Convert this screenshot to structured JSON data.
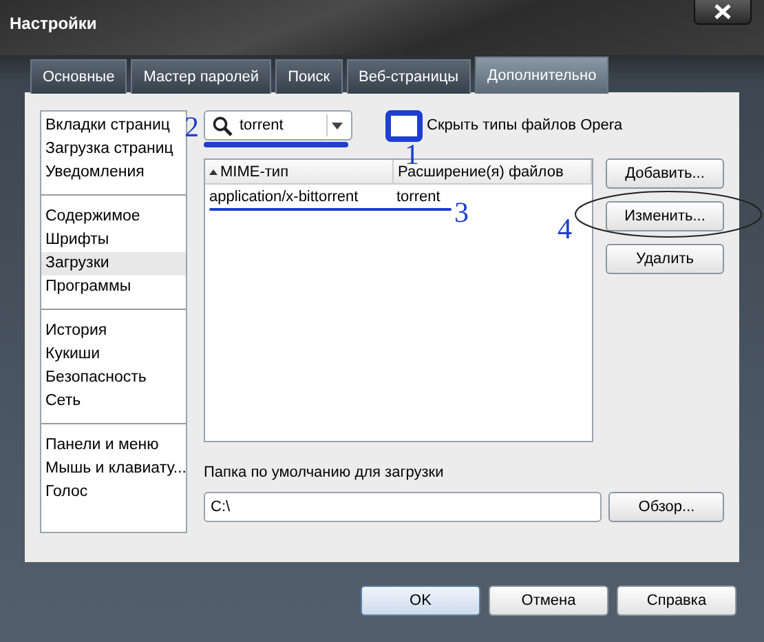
{
  "window": {
    "title": "Настройки"
  },
  "tabs": [
    {
      "label": "Основные",
      "selected": false
    },
    {
      "label": "Мастер паролей",
      "selected": false
    },
    {
      "label": "Поиск",
      "selected": false
    },
    {
      "label": "Веб-страницы",
      "selected": false
    },
    {
      "label": "Дополнительно",
      "selected": true
    }
  ],
  "sidebar": {
    "groups": [
      {
        "items": [
          {
            "label": "Вкладки страниц",
            "selected": false
          },
          {
            "label": "Загрузка страниц",
            "selected": false
          },
          {
            "label": "Уведомления",
            "selected": false
          }
        ]
      },
      {
        "items": [
          {
            "label": "Содержимое",
            "selected": false
          },
          {
            "label": "Шрифты",
            "selected": false
          },
          {
            "label": "Загрузки",
            "selected": true
          },
          {
            "label": "Программы",
            "selected": false
          }
        ]
      },
      {
        "items": [
          {
            "label": "История",
            "selected": false
          },
          {
            "label": "Кукиши",
            "selected": false
          },
          {
            "label": "Безопасность",
            "selected": false
          },
          {
            "label": "Сеть",
            "selected": false
          }
        ]
      },
      {
        "items": [
          {
            "label": "Панели и меню",
            "selected": false
          },
          {
            "label": "Мышь и клавиату...",
            "selected": false
          },
          {
            "label": "Голос",
            "selected": false
          }
        ]
      }
    ]
  },
  "search": {
    "value": "torrent"
  },
  "hide_opera_types": {
    "label": "Скрыть типы файлов Opera",
    "checked": false
  },
  "table": {
    "columns": [
      {
        "label": "MIME-тип",
        "sorted": true
      },
      {
        "label": "Расширение(я) файлов",
        "sorted": false
      }
    ],
    "rows": [
      {
        "cells": [
          "application/x-bittorrent",
          "torrent"
        ]
      }
    ]
  },
  "side_buttons": [
    "Добавить...",
    "Изменить...",
    "Удалить"
  ],
  "download_folder": {
    "label": "Папка по умолчанию для загрузки",
    "value": "C:\\",
    "button": "Обзор..."
  },
  "buttons": [
    {
      "label": "OK",
      "default": true
    },
    {
      "label": "Отмена",
      "default": false
    },
    {
      "label": "Справка",
      "default": false
    }
  ],
  "annotations": [
    {
      "label": "1"
    },
    {
      "label": "2"
    },
    {
      "label": "3"
    },
    {
      "label": "4"
    }
  ]
}
